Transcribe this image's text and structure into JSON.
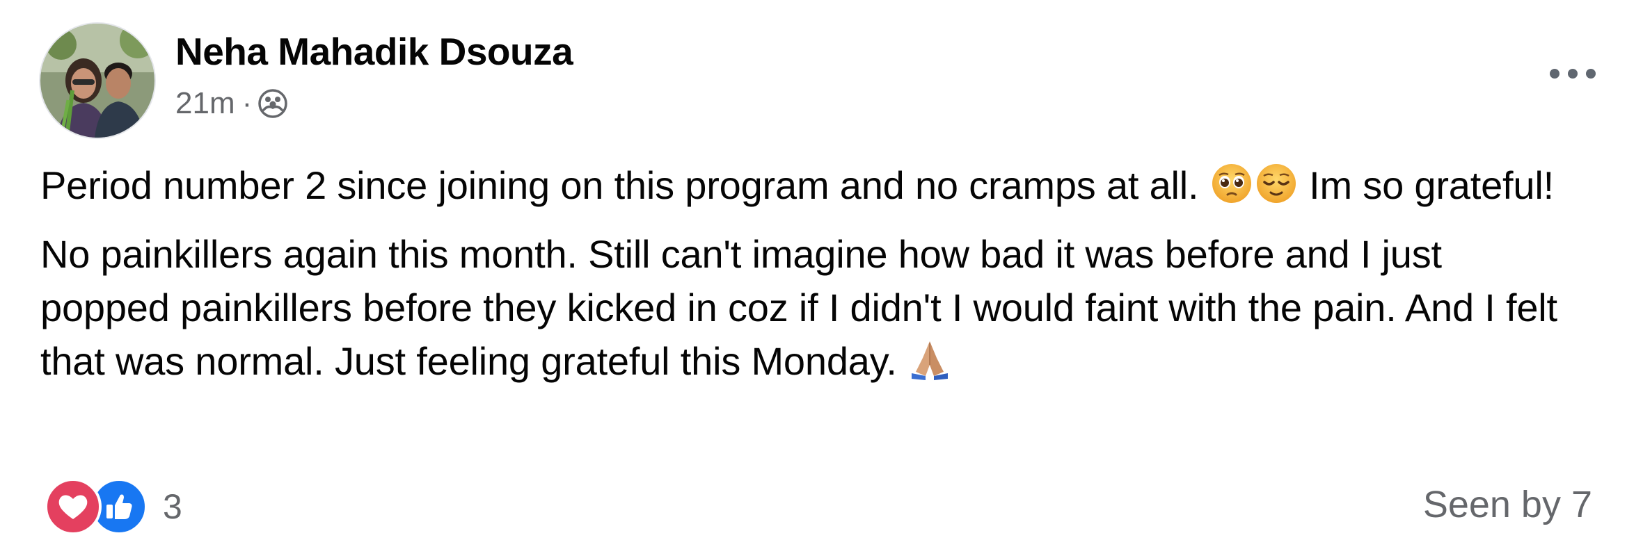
{
  "post": {
    "author": "Neha Mahadik Dsouza",
    "time": "21m",
    "separator": "·",
    "audience_icon": "group-audience-icon",
    "more_icon": "more-options-icon",
    "paragraphs": {
      "p1_a": "Period number 2 since joining on this program and no cramps at all.",
      "p1_emoji_1": "pleading-face-emoji",
      "p1_emoji_2": "relieved-face-emoji",
      "p1_b": "Im so grateful!",
      "p2_a": "No painkillers again this month. Still can't imagine how bad it was before and I just popped painkillers before they kicked in coz if I didn't I would faint with the pain. And I felt that was normal. Just feeling grateful this Monday.",
      "p2_emoji": "folded-hands-emoji"
    },
    "reactions": {
      "types": [
        "love-reaction-icon",
        "like-reaction-icon"
      ],
      "count": "3"
    },
    "seen_by": "Seen by 7"
  },
  "colors": {
    "text": "#050505",
    "secondary": "#65676b",
    "love": "#e4405f",
    "like": "#1877f2"
  }
}
